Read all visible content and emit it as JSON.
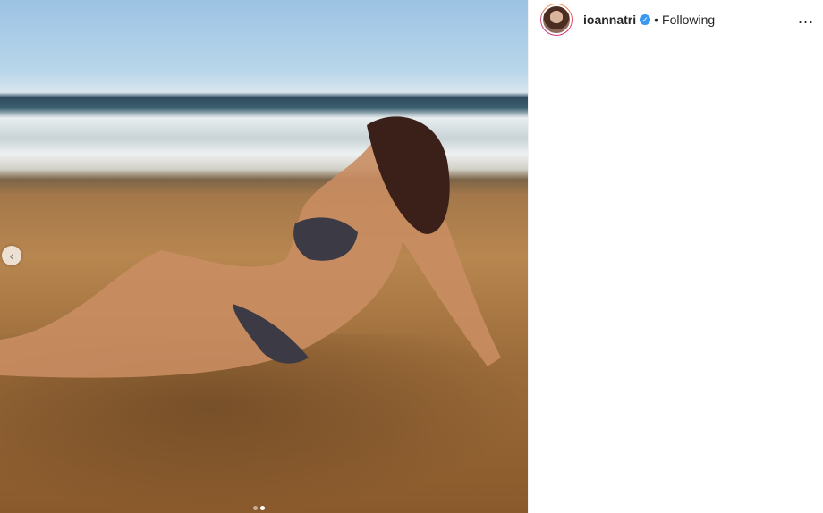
{
  "post": {
    "image": {
      "description_icon": "photo"
    },
    "carousel": {
      "prev_icon": "chevron-left-icon",
      "dot_count": 2,
      "active_index": 1
    }
  },
  "header": {
    "username": "ioannatri",
    "verified_icon": "verified-badge-icon",
    "separator": "•",
    "follow_status": "Following",
    "more_label": "..."
  },
  "colors": {
    "verified": "#3897f0",
    "text": "#262626",
    "border": "#efefef"
  }
}
